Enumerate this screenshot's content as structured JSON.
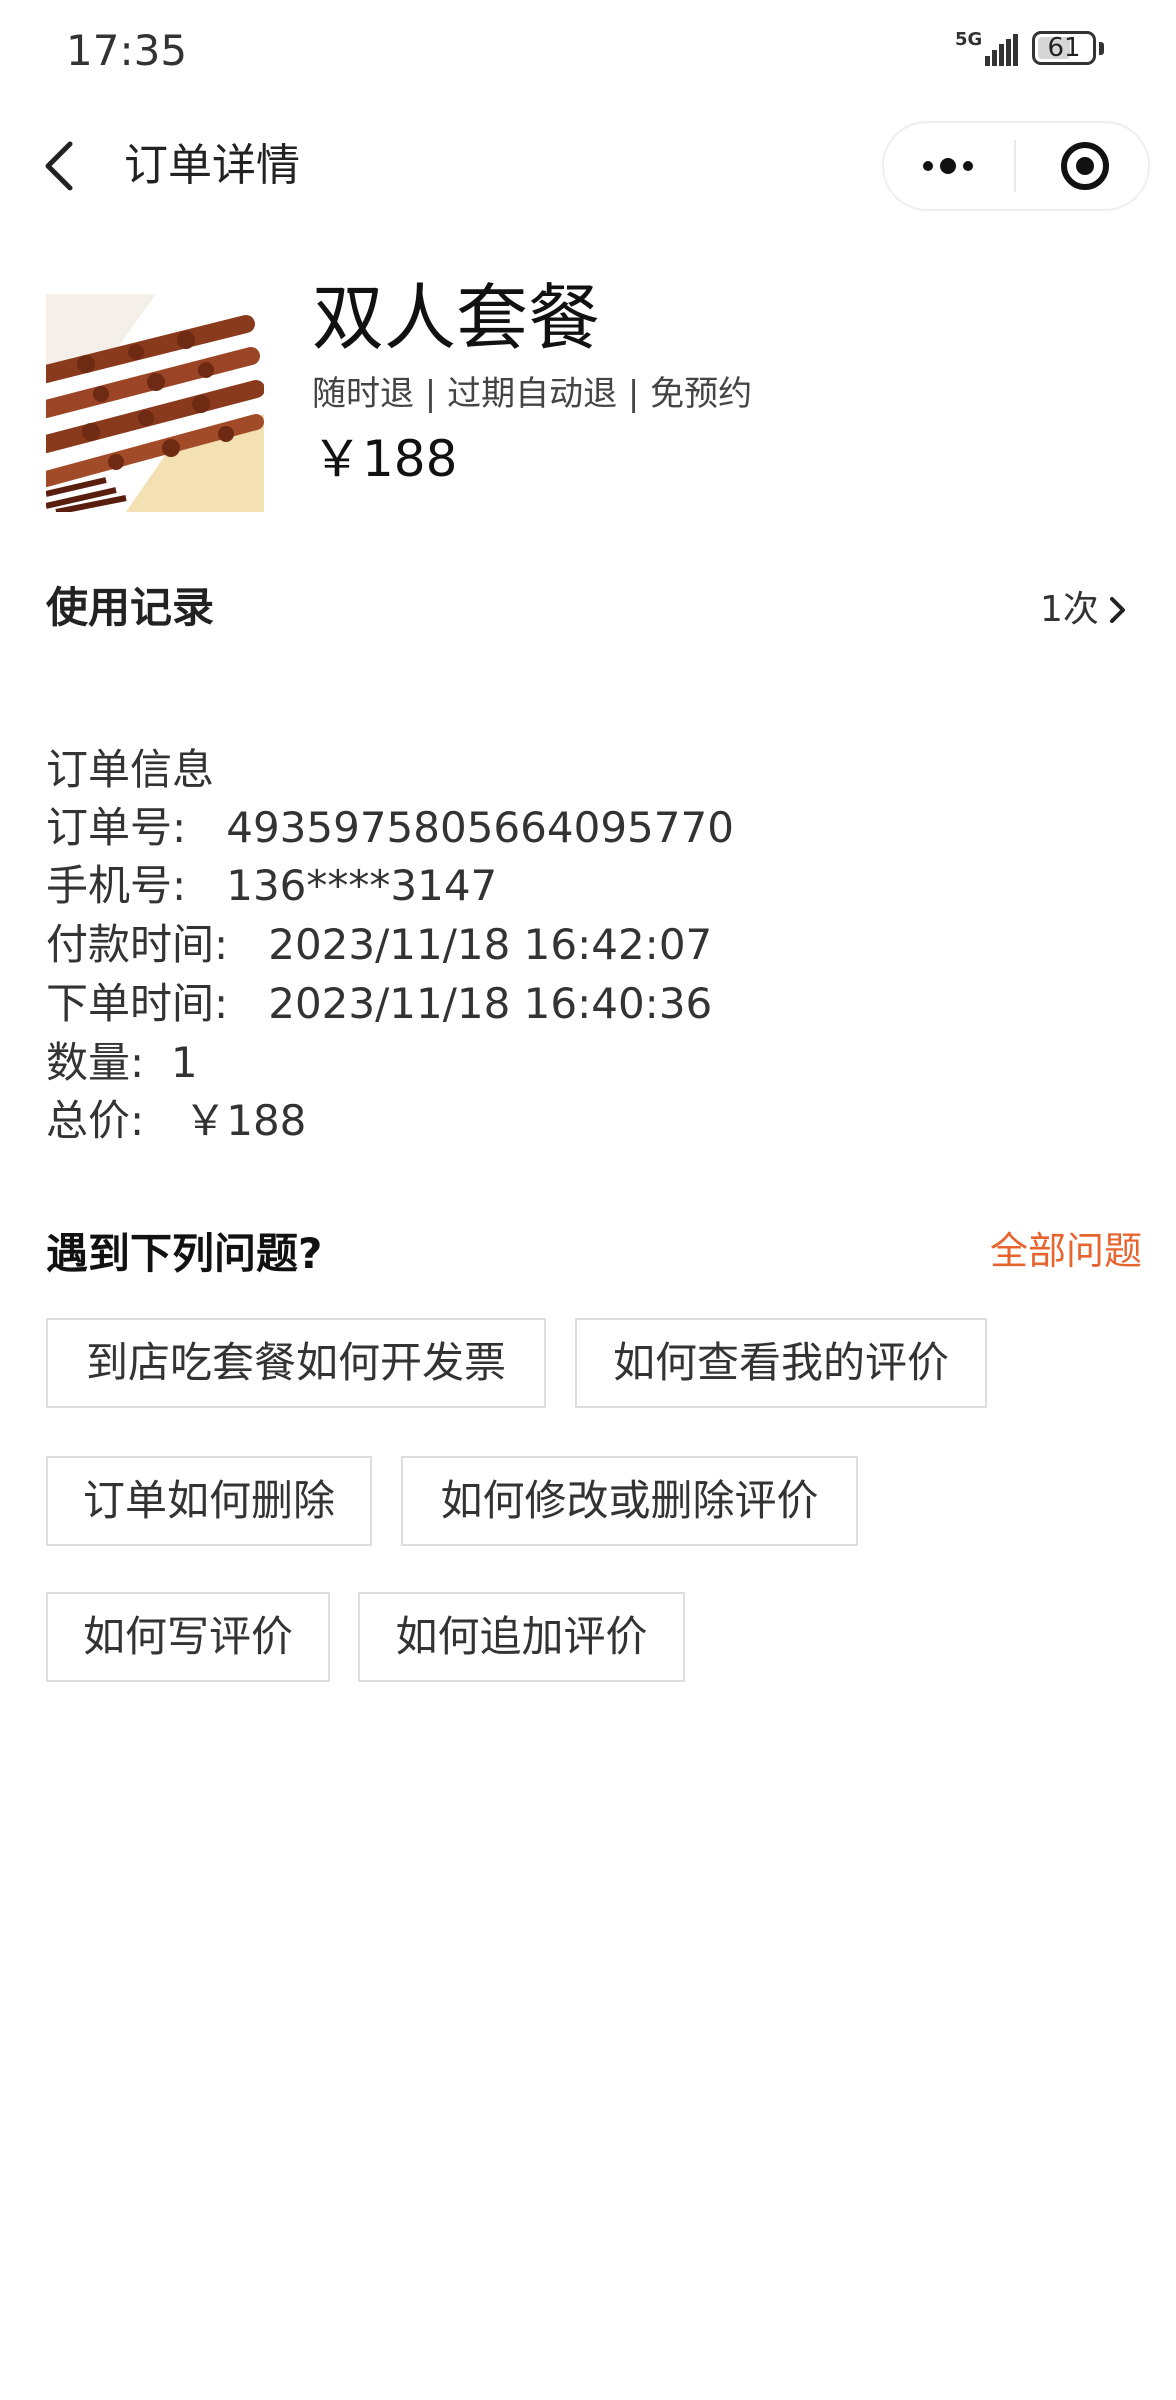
{
  "status_bar": {
    "time": "17:35",
    "network": "5G",
    "battery": "61",
    "battery_level_percent": 61,
    "signal_icon": "cellular-signal-icon",
    "battery_icon": "battery-icon"
  },
  "nav": {
    "title": "订单详情",
    "back_icon": "back-chevron-icon",
    "more_icon": "more-dots-icon",
    "close_icon": "target-circle-icon"
  },
  "product": {
    "title": "双人套餐",
    "tags": "随时退 | 过期自动退 | 免预约",
    "price": "￥188"
  },
  "usage": {
    "label": "使用记录",
    "count": "1次"
  },
  "order_info": {
    "title": "订单信息",
    "lines": [
      {
        "label": "订单号:",
        "value": "4935975805664095770"
      },
      {
        "label": "手机号:",
        "value": "136****3147"
      },
      {
        "label": "付款时间:",
        "value": "2023/11/18 16:42:07"
      },
      {
        "label": "下单时间:",
        "value": "2023/11/18 16:40:36"
      },
      {
        "label": "数量:",
        "value": "1"
      },
      {
        "label": "总价:",
        "value": "￥188"
      }
    ]
  },
  "faq": {
    "title": "遇到下列问题?",
    "all_link": "全部问题",
    "accent_color": "#e8642f",
    "questions": [
      "到店吃套餐如何开发票",
      "如何查看我的评价",
      "订单如何删除",
      "如何修改或删除评价",
      "如何写评价",
      "如何追加评价"
    ]
  }
}
